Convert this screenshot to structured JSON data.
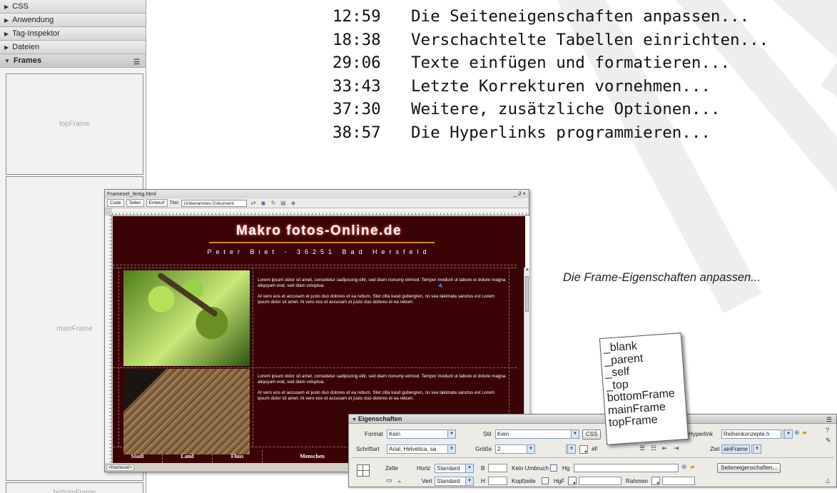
{
  "left_panel": {
    "headers": [
      {
        "label": "CSS",
        "icon": "triangle-right-icon"
      },
      {
        "label": "Anwendung",
        "icon": "triangle-right-icon"
      },
      {
        "label": "Tag-Inspektor",
        "icon": "triangle-right-icon"
      },
      {
        "label": "Dateien",
        "icon": "triangle-right-icon"
      },
      {
        "label": "Frames",
        "icon": "triangle-down-icon"
      }
    ],
    "frames": [
      "topFrame",
      "mainFrame",
      "bottomFrame"
    ]
  },
  "chapters": [
    {
      "time": "12:59",
      "title": "Die Seiteneigenschaften anpassen..."
    },
    {
      "time": "18:38",
      "title": "Verschachtelte Tabellen einrichten..."
    },
    {
      "time": "29:06",
      "title": "Texte einfügen und formatieren..."
    },
    {
      "time": "33:43",
      "title": "Letzte Korrekturen vornehmen..."
    },
    {
      "time": "37:30",
      "title": "Weitere, zusätzliche Optionen..."
    },
    {
      "time": "38:57",
      "title": "Die Hyperlinks programmieren..."
    }
  ],
  "caption": "Die Frame-Eigenschaften anpassen...",
  "document": {
    "window_title": "Frameset_fertig.html",
    "window_controls": "_ ∂ ×",
    "toolbar": {
      "code_label": "Code",
      "split_label": "Teilen",
      "design_label": "Entwurf",
      "title_label": "Titel:",
      "title_value": "Unbenanntes Dokument"
    },
    "site_title": "Makro fotos-Online.de",
    "site_subtitle": "Peter Biet - 36251 Bad Hersfeld",
    "lorem_p1": "Lorem ipsum dolor sit amet, consetetur sadipscing elitr, sed diam nonumy eirmod. Tempor invidunt ut labore et dolore magna aliquyam erat, sed diam voluptua.",
    "lorem_p2": "At vero eos et accusam et justo duo dolores et ea rebum. Stet clita kasd gubergren, no sea takimata sanctus est Lorem ipsum dolor sit amet. At vero eos et accusam et justo duo dolores et ea rebum.",
    "nav_items": [
      "Stadt",
      "Land",
      "Fluss",
      "Menschen"
    ],
    "status_tag": "<frameset>"
  },
  "properties": {
    "header": "Eigenschaften",
    "format_label": "Format",
    "format_value": "Kein",
    "stil_label": "Stil",
    "stil_value": "Kein",
    "css_button": "CSS",
    "schriftart_label": "Schriftart",
    "schriftart_value": "Arial, Helvetica, sa",
    "groesse_label": "Größe",
    "groesse_value": "2",
    "color_value": "#F",
    "hyperlink_label": "Hyperlink",
    "hyperlink_value": "Reihenkonzepte.h",
    "ziel_label": "Ziel",
    "ziel_value": "ainFrame",
    "zelle_label": "Zelle",
    "horiz_label": "Horiz",
    "horiz_value": "Standard",
    "vert_label": "Vert",
    "vert_value": "Standard",
    "b_label": "B",
    "h_label": "H",
    "kein_umbruch_label": "Kein Umbruch",
    "kopfzeile_label": "Kopfzeile",
    "hg_label": "Hg",
    "hgf_label": "HgF",
    "rahmen_label": "Rahmen",
    "seiteneigenschaften_button": "Seiteneigenschaften..."
  },
  "target_dropdown": [
    "_blank",
    "_parent",
    "_self",
    "_top",
    "bottomFrame",
    "mainFrame",
    "topFrame"
  ]
}
